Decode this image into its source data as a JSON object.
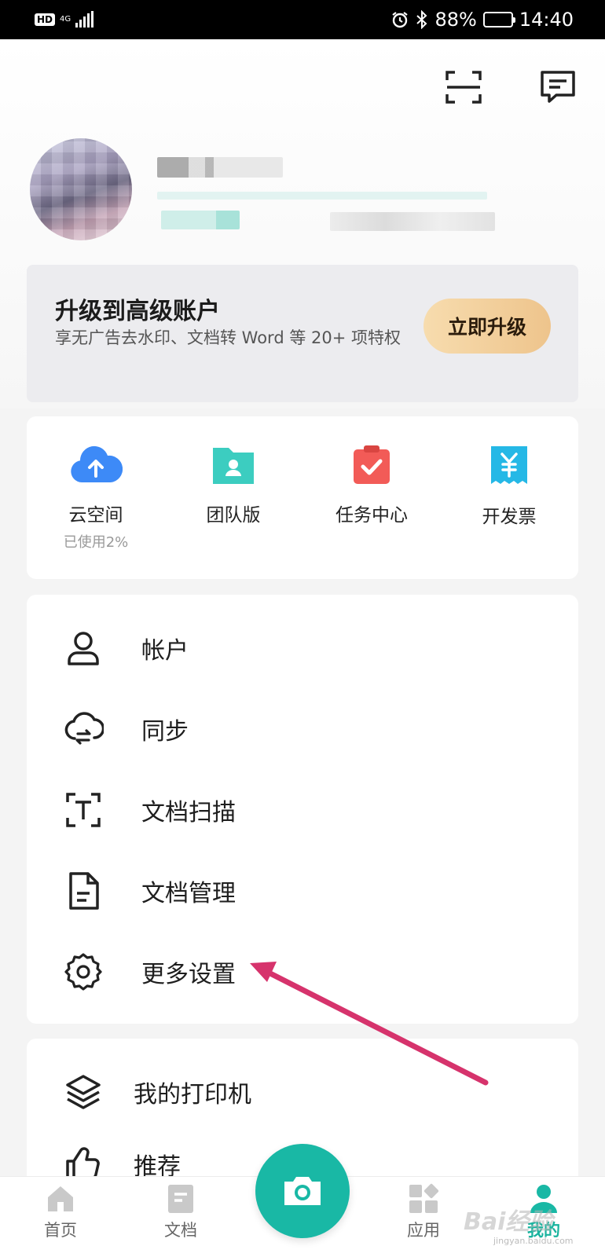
{
  "status_bar": {
    "hd": "HD",
    "network": "4G",
    "battery_percent": "88%",
    "time": "14:40",
    "battery_level": 0.88
  },
  "header": {
    "scan_icon": "scan-icon",
    "message_icon": "message-icon"
  },
  "upgrade": {
    "title": "升级到高级账户",
    "description": "享无广告去水印、文档转 Word 等 20+ 项特权",
    "button": "立即升级"
  },
  "quick_actions": [
    {
      "label": "云空间",
      "sub": "已使用2%",
      "icon": "cloud-upload-icon",
      "color": "#3d8af7"
    },
    {
      "label": "团队版",
      "sub": "",
      "icon": "team-folder-icon",
      "color": "#3ccdc0"
    },
    {
      "label": "任务中心",
      "sub": "",
      "icon": "task-clipboard-icon",
      "color": "#f25b57"
    },
    {
      "label": "开发票",
      "sub": "",
      "icon": "invoice-icon",
      "color": "#25b8e6"
    }
  ],
  "menu": [
    {
      "label": "帐户",
      "icon": "user-icon"
    },
    {
      "label": "同步",
      "icon": "cloud-sync-icon"
    },
    {
      "label": "文档扫描",
      "icon": "text-scan-icon"
    },
    {
      "label": "文档管理",
      "icon": "document-icon"
    },
    {
      "label": "更多设置",
      "icon": "gear-icon"
    }
  ],
  "menu2": [
    {
      "label": "我的打印机",
      "icon": "layers-icon"
    },
    {
      "label": "推荐",
      "icon": "thumbs-up-icon"
    }
  ],
  "bottom_nav": [
    {
      "label": "首页",
      "icon": "home-icon"
    },
    {
      "label": "文档",
      "icon": "document-tab-icon"
    },
    {
      "label": "应用",
      "icon": "apps-icon"
    },
    {
      "label": "我的",
      "icon": "profile-icon",
      "active": true
    }
  ],
  "colors": {
    "accent": "#19b8a5",
    "annotation_arrow": "#d6336c",
    "upgrade_button": "#f2cf9a"
  },
  "watermark": {
    "text": "Bai经验",
    "sub": "jingyan.baidu.com"
  }
}
